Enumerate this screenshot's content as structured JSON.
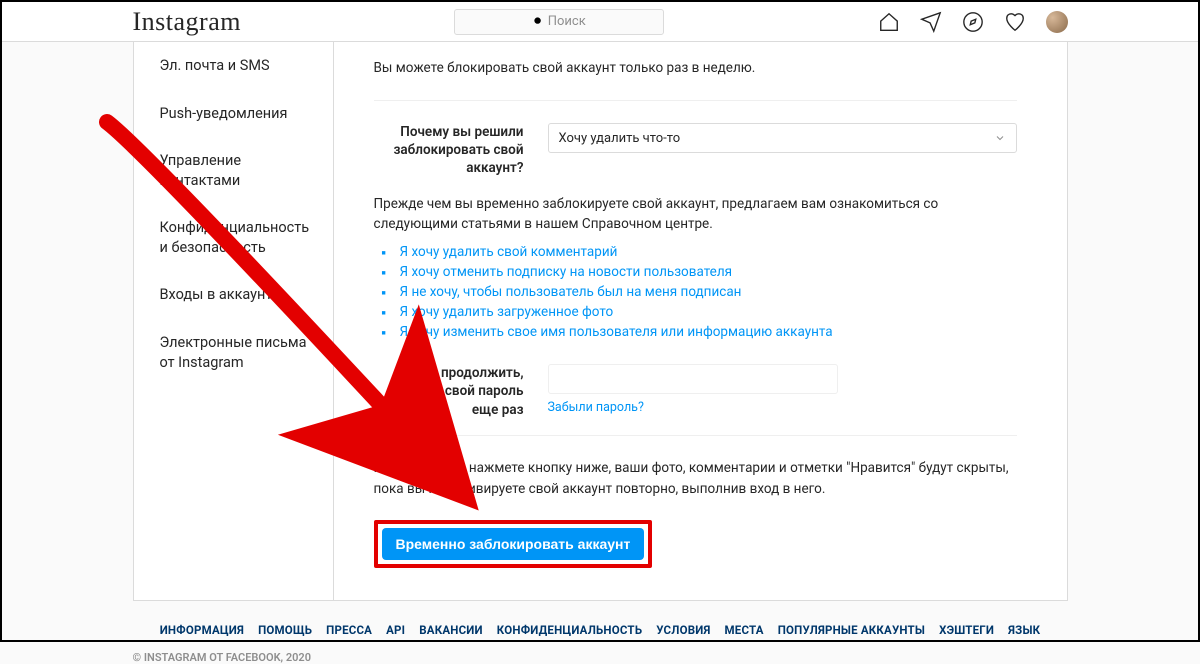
{
  "header": {
    "logo_text": "Instagram",
    "search_placeholder": "Поиск",
    "icons": [
      "home-icon",
      "direct-icon",
      "explore-icon",
      "activity-icon"
    ]
  },
  "sidebar": {
    "items": [
      {
        "label": "Эл. почта и SMS"
      },
      {
        "label": "Push-уведомления"
      },
      {
        "label": "Управление контактами"
      },
      {
        "label": "Конфиденциальность и безопасность"
      },
      {
        "label": "Входы в аккаунт"
      },
      {
        "label": "Электронные письма от Instagram"
      }
    ]
  },
  "content": {
    "limit_text": "Вы можете блокировать свой аккаунт только раз в неделю.",
    "reason_label": "Почему вы решили заблокировать свой аккаунт?",
    "reason_selected": "Хочу удалить что-то",
    "before_text": "Прежде чем вы временно заблокируете свой аккаунт, предлагаем вам ознакомиться со следующими статьями в нашем Справочном центре.",
    "help_links": [
      "Я хочу удалить свой комментарий",
      "Я хочу отменить подписку на новости пользователя",
      "Я не хочу, чтобы пользователь был на меня подписан",
      "Я хочу удалить загруженное фото",
      "Я хочу изменить свое имя пользователя или информацию аккаунта"
    ],
    "password_label": "Чтобы продолжить, введите свой пароль еще раз",
    "forgot_text": "Забыли пароль?",
    "final_text": "Как только вы нажмете кнопку ниже, ваши фото, комментарии и отметки \"Нравится\" будут скрыты, пока вы не активируете свой аккаунт повторно, выполнив вход в него.",
    "submit_button": "Временно заблокировать аккаунт"
  },
  "footer": {
    "links": [
      "ИНФОРМАЦИЯ",
      "ПОМОЩЬ",
      "ПРЕССА",
      "API",
      "ВАКАНСИИ",
      "КОНФИДЕНЦИАЛЬНОСТЬ",
      "УСЛОВИЯ",
      "МЕСТА",
      "ПОПУЛЯРНЫЕ АККАУНТЫ",
      "ХЭШТЕГИ",
      "ЯЗЫК"
    ],
    "copyright": "© INSTAGRAM ОТ FACEBOOK, 2020"
  },
  "annotation": {
    "arrow_color": "#e30000"
  }
}
